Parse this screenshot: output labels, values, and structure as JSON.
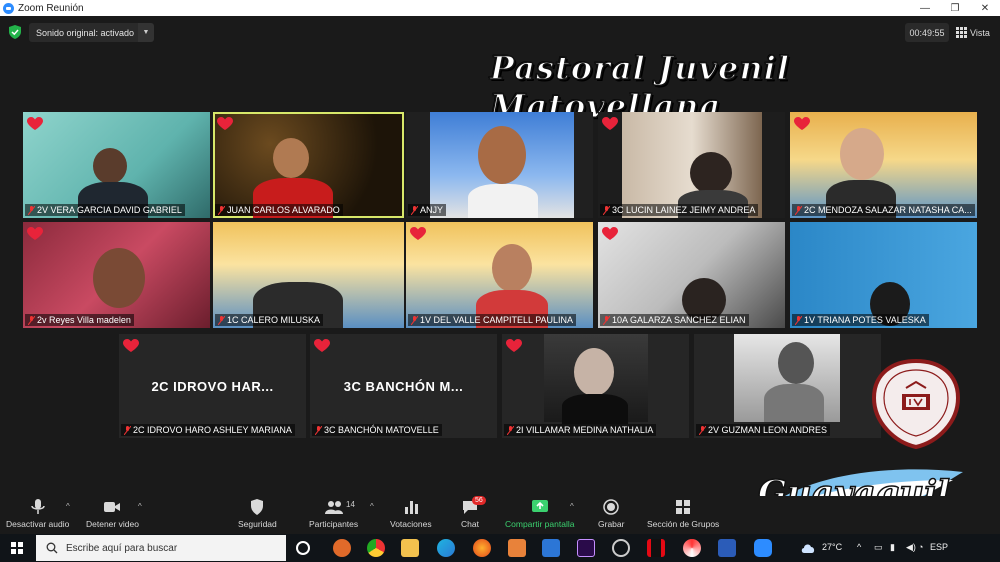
{
  "window": {
    "title": "Zoom Reunión"
  },
  "topbar": {
    "sound_label": "Sonido original: activado",
    "timer": "00:49:55",
    "view_label": "Vista"
  },
  "overlays": {
    "banner": "Pastoral Juvenil Matovellana",
    "city": "Guayaquil"
  },
  "participants": [
    {
      "name": "2V VERA GARCIA DAVID GABRIEL",
      "heart": true
    },
    {
      "name": "JUAN CARLOS ALVARADO",
      "heart": true,
      "active": true
    },
    {
      "name": "ANJY",
      "heart": false
    },
    {
      "name": "3C LUCIN LAINEZ JEIMY ANDREA",
      "heart": true
    },
    {
      "name": "2C MENDOZA SALAZAR NATASHA CA...",
      "heart": true
    },
    {
      "name": "2v Reyes Villa madelen",
      "heart": true
    },
    {
      "name": "1C CALERO MILUSKA",
      "heart": false
    },
    {
      "name": "1V DEL VALLE CAMPITELL PAULINA",
      "heart": true
    },
    {
      "name": "10A GALARZA SANCHEZ ELIAN",
      "heart": true
    },
    {
      "name": "1V TRIANA POTES VALESKA",
      "heart": false
    },
    {
      "name": "2C IDROVO HARO ASHLEY MARIANA",
      "heart": true,
      "placeholder": "2C IDROVO HAR..."
    },
    {
      "name": "3C BANCHÓN MATOVELLE",
      "heart": true,
      "placeholder": "3C BANCHÓN M..."
    },
    {
      "name": "2I VILLAMAR MEDINA NATHALIA",
      "heart": true
    },
    {
      "name": "2V GUZMAN LEON ANDRES",
      "heart": false
    }
  ],
  "toolbar": {
    "mute": "Desactivar audio",
    "video": "Detener video",
    "security": "Seguridad",
    "participants": "Participantes",
    "participants_count": "14",
    "polls": "Votaciones",
    "chat": "Chat",
    "chat_badge": "56",
    "share": "Compartir pantalla",
    "record": "Grabar",
    "rooms": "Sección de Grupos"
  },
  "taskbar": {
    "search_placeholder": "Escribe aquí para buscar",
    "temperature": "27°C",
    "language": "ESP"
  },
  "colors": {
    "active_speaker": "#d8e86a",
    "share_green": "#3bd16f",
    "heart": "#e8233a",
    "badge": "#e02828"
  }
}
